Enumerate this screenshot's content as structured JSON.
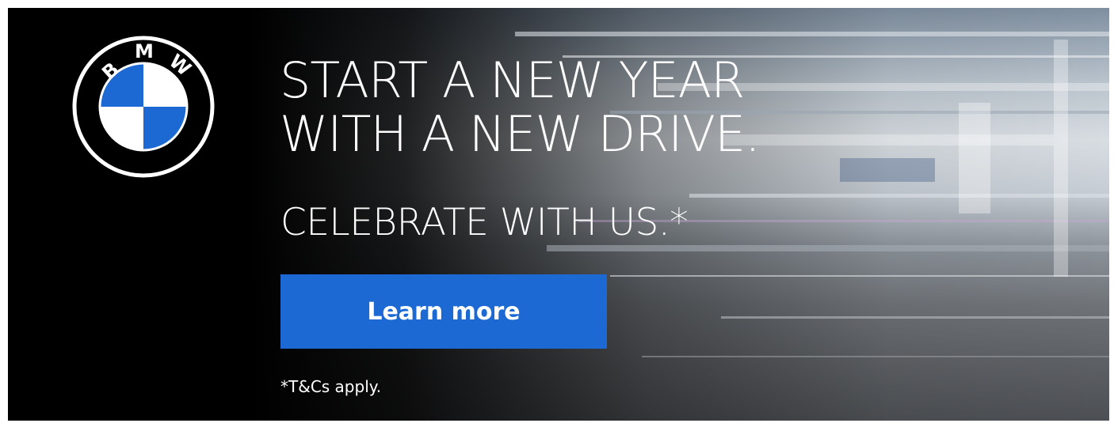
{
  "brand": {
    "name": "BMW",
    "logo_letters": [
      "B",
      "M",
      "W"
    ],
    "logo_icon": "bmw-roundel-icon",
    "blue": "#1c69d4"
  },
  "headline": {
    "line1": "START A NEW YEAR",
    "line2": "WITH A NEW DRIVE."
  },
  "subheadline": "CELEBRATE WITH US.*",
  "cta": {
    "label": "Learn more",
    "color": "#1c69d4"
  },
  "disclaimer": "*T&Cs apply."
}
